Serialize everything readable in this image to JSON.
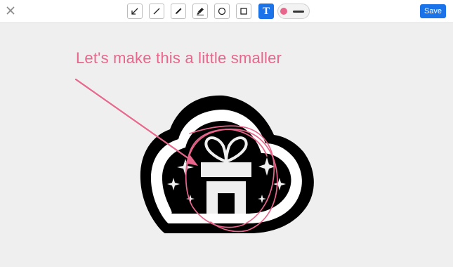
{
  "colors": {
    "accent": "#1a73e8",
    "annotation": "#e8668c",
    "logo": "#000000"
  },
  "toolbar": {
    "close_icon": "close-icon",
    "tools": [
      {
        "name": "arrow",
        "icon": "arrow-icon"
      },
      {
        "name": "line",
        "icon": "line-icon"
      },
      {
        "name": "pen",
        "icon": "pen-icon"
      },
      {
        "name": "highlighter",
        "icon": "highlighter-icon"
      },
      {
        "name": "circle",
        "icon": "circle-icon"
      },
      {
        "name": "rectangle",
        "icon": "rectangle-icon"
      },
      {
        "name": "text",
        "icon": "text-icon",
        "glyph": "T",
        "active": true
      }
    ],
    "stroke_color": "#e8668c",
    "save_label": "Save"
  },
  "canvas": {
    "annotation_text": "Let's make this a little smaller",
    "image": "gift-cloud-logo"
  }
}
